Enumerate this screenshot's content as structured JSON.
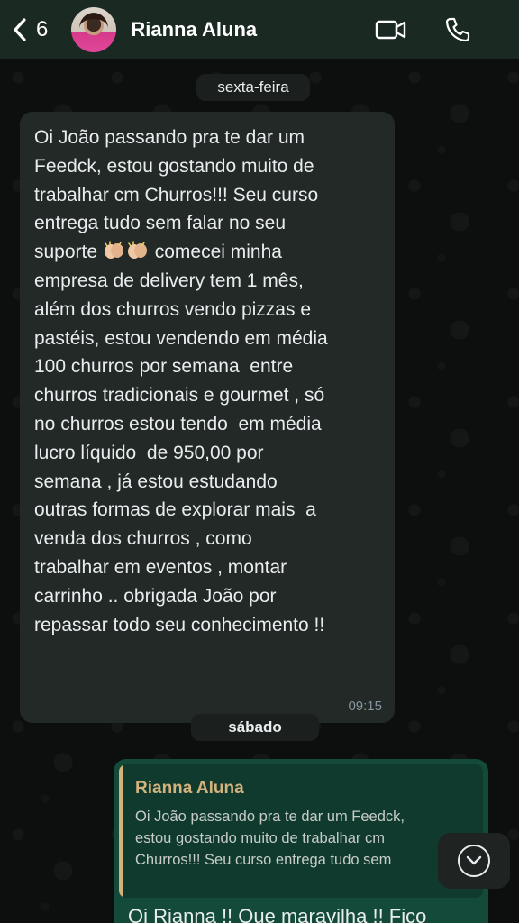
{
  "header": {
    "unread_count": "6",
    "contact_name": "Rianna Aluna"
  },
  "chat": {
    "day_separators": [
      "sexta-feira",
      "sábado"
    ],
    "incoming_message": {
      "text_before_emoji": "Oi João passando pra te dar um\nFeedck, estou gostando muito de\ntrabalhar cm Churros!!! Seu curso\nentrega tudo sem falar no seu\nsuporte ",
      "emoji": "👏🏼👏🏼",
      "text_after_emoji": " comecei minha\nempresa de delivery tem 1 mês,\nalém dos churros vendo pizzas e\npastéis, estou vendendo em média\n100 churros por semana  entre\nchurros tradicionais e gourmet , só\nno churros estou tendo  em média\nlucro líquido  de 950,00 por\nsemana , já estou estudando\noutras formas de explorar mais  a\nvenda dos churros , como\ntrabalhar em eventos , montar\ncarrinho .. obrigada João por\nrepassar todo seu conhecimento !!",
      "time": "09:15"
    },
    "outgoing_message": {
      "quoted_author": "Rianna Aluna",
      "quoted_text": "Oi João passando pra te dar um Feedck,\nestou gostando muito de trabalhar cm\nChurros!!! Seu curso entrega tudo sem",
      "text": "Oi Rianna !! Que maravilha !! Fico"
    }
  },
  "icons": [
    "chevron-left-icon",
    "video-camera-icon",
    "phone-icon",
    "clapping-hands-icon",
    "chevron-down-icon"
  ],
  "colors": {
    "header_bg": "#1a2922",
    "incoming_bubble": "#222926",
    "outgoing_bubble": "#144a39",
    "quote_accent": "#d4b27c",
    "timestamp": "#8696a0"
  }
}
